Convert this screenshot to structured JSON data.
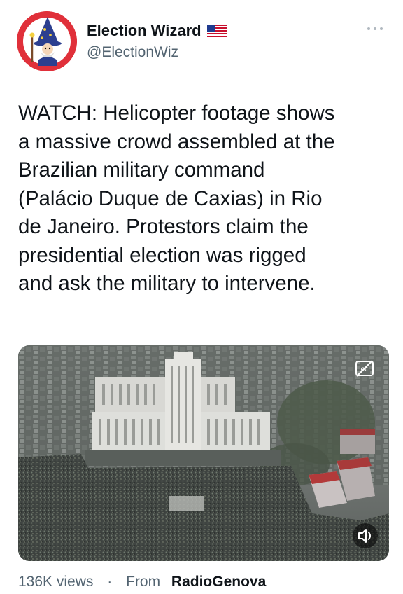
{
  "author": {
    "display_name": "Election Wizard",
    "handle": "@ElectionWiz",
    "flag_icon": "us-flag-icon"
  },
  "tweet": {
    "text": "WATCH: Helicopter footage shows\na massive crowd assembled at the\nBrazilian military command\n(Palácio Duque de Caxias) in Rio\nde Janeiro. Protestors claim the\npresidential election was rigged\nand ask the military to intervene."
  },
  "media": {
    "type": "video",
    "controls": [
      "captions-icon",
      "volume-icon"
    ]
  },
  "footer": {
    "views": "136K views",
    "separator": "·",
    "from_label": "From",
    "source": "RadioGenova"
  },
  "colors": {
    "avatar_bg": "#e0303a",
    "muted_text": "#536471",
    "primary_text": "#0f1419"
  }
}
